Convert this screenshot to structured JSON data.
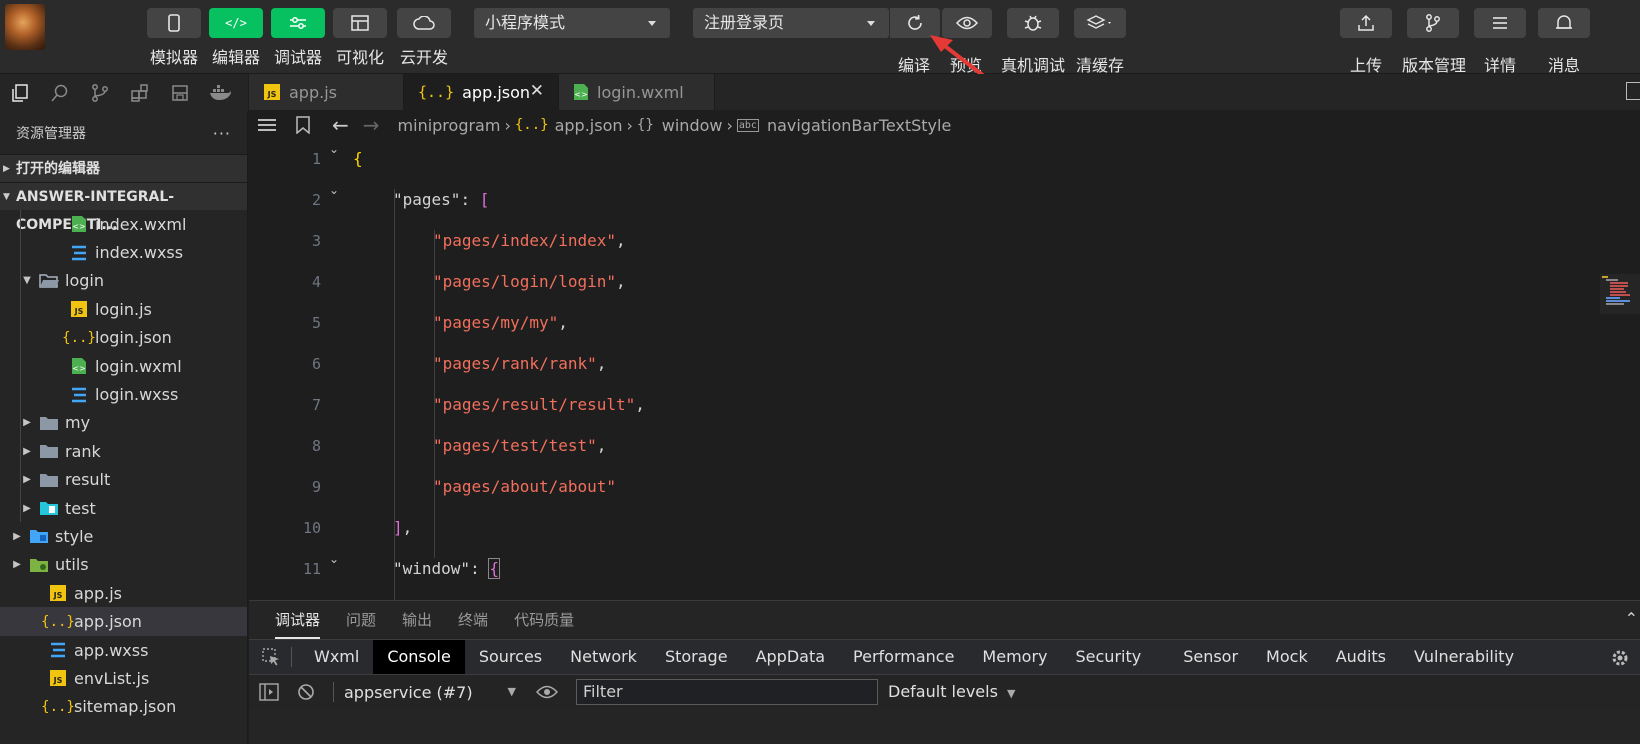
{
  "toolbar": {
    "buttons": [
      {
        "label": "模拟器",
        "icon": "phone-icon"
      },
      {
        "label": "编辑器",
        "icon": "code-icon"
      },
      {
        "label": "调试器",
        "icon": "sliders-icon"
      },
      {
        "label": "可视化",
        "icon": "layout-icon"
      },
      {
        "label": "云开发",
        "icon": "cloud-icon"
      }
    ],
    "mode_select": "小程序模式",
    "page_select": "注册登录页",
    "compile_label": "编译",
    "preview_label": "预览",
    "real_debug_label": "真机调试",
    "clear_cache_label": "清缓存",
    "upload_label": "上传",
    "version_label": "版本管理",
    "details_label": "详情",
    "messages_label": "消息",
    "accent_color": "#07c160"
  },
  "sidebar": {
    "title": "资源管理器",
    "more": "···",
    "open_editors": "打开的编辑器",
    "project": "ANSWER-INTEGRAL-COMPETITI...",
    "items": [
      {
        "label": "index.wxml",
        "type": "wxml"
      },
      {
        "label": "index.wxss",
        "type": "wxss"
      },
      {
        "label": "login",
        "type": "folder-open"
      },
      {
        "label": "login.js",
        "type": "js"
      },
      {
        "label": "login.json",
        "type": "json"
      },
      {
        "label": "login.wxml",
        "type": "wxml"
      },
      {
        "label": "login.wxss",
        "type": "wxss"
      },
      {
        "label": "my",
        "type": "folder"
      },
      {
        "label": "rank",
        "type": "folder"
      },
      {
        "label": "result",
        "type": "folder"
      },
      {
        "label": "test",
        "type": "folder-test"
      },
      {
        "label": "style",
        "type": "folder-style"
      },
      {
        "label": "utils",
        "type": "folder-utils"
      },
      {
        "label": "app.js",
        "type": "js"
      },
      {
        "label": "app.json",
        "type": "json"
      },
      {
        "label": "app.wxss",
        "type": "wxss"
      },
      {
        "label": "envList.js",
        "type": "js"
      },
      {
        "label": "sitemap.json",
        "type": "json"
      }
    ]
  },
  "editor": {
    "tabs": [
      {
        "label": "app.js",
        "type": "js"
      },
      {
        "label": "app.json",
        "type": "json"
      },
      {
        "label": "login.wxml",
        "type": "wxml"
      }
    ],
    "breadcrumb": [
      "miniprogram",
      "app.json",
      "window",
      "navigationBarTextStyle"
    ],
    "breadcrumb_json_icon": "{..}",
    "breadcrumb_obj_icon": "{}",
    "lines": [
      {
        "n": "1",
        "text": "{"
      },
      {
        "n": "2",
        "key": "\"pages\"",
        "colon": ": ",
        "open": "["
      },
      {
        "n": "3",
        "str": "\"pages/index/index\"",
        "tail": ","
      },
      {
        "n": "4",
        "str": "\"pages/login/login\"",
        "tail": ","
      },
      {
        "n": "5",
        "str": "\"pages/my/my\"",
        "tail": ","
      },
      {
        "n": "6",
        "str": "\"pages/rank/rank\"",
        "tail": ","
      },
      {
        "n": "7",
        "str": "\"pages/result/result\"",
        "tail": ","
      },
      {
        "n": "8",
        "str": "\"pages/test/test\"",
        "tail": ","
      },
      {
        "n": "9",
        "str": "\"pages/about/about\"",
        "tail": ""
      },
      {
        "n": "10",
        "close": "]",
        "tail": ","
      },
      {
        "n": "11",
        "key": "\"window\"",
        "colon": ": ",
        "open": "{"
      }
    ]
  },
  "panel": {
    "tabs": [
      "调试器",
      "问题",
      "输出",
      "终端",
      "代码质量"
    ],
    "devtools_tabs": [
      "Wxml",
      "Console",
      "Sources",
      "Network",
      "Storage",
      "AppData",
      "Performance",
      "Memory",
      "Security",
      "Sensor",
      "Mock",
      "Audits",
      "Vulnerability"
    ],
    "context": "appservice (#7)",
    "filter_placeholder": "Filter",
    "levels": "Default levels"
  }
}
